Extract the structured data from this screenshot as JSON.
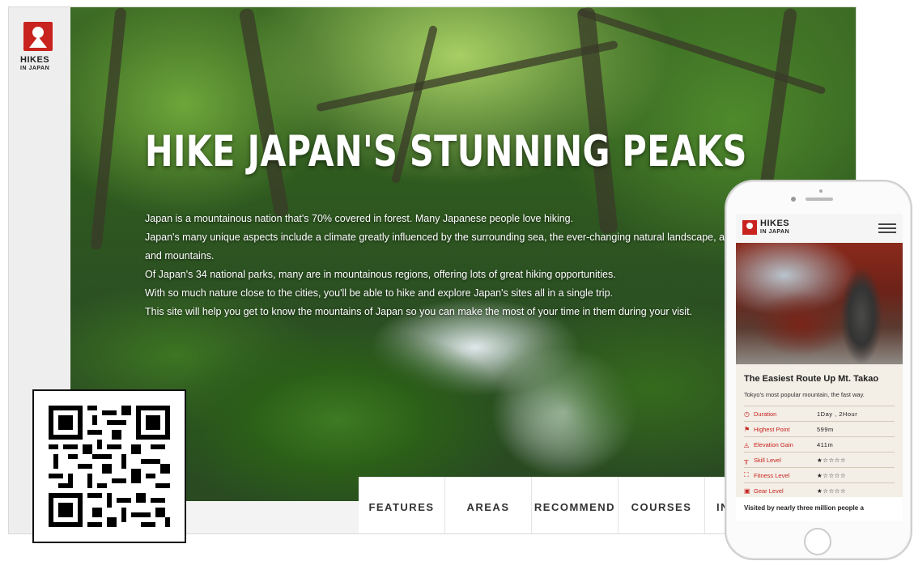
{
  "site": {
    "logo": {
      "line1": "HIKES",
      "line2": "IN JAPAN"
    }
  },
  "hero": {
    "title": "HIKE JAPAN'S STUNNING PEAKS",
    "paragraphs": [
      "Japan is a mountainous nation that's 70% covered in forest. Many Japanese people love hiking.",
      "Japan's many unique aspects include a climate greatly influenced by the surrounding sea, the ever-changing natural landscape, and th",
      "and mountains.",
      "Of Japan's 34 national parks, many are in mountainous regions, offering lots of great hiking opportunities.",
      "With so much nature close to the cities, you'll be able to hike and explore Japan's sites all in a single trip.",
      "This site will help you get to know the mountains of Japan so you can make the most of your time in them during your visit."
    ]
  },
  "nav": {
    "items": [
      "FEATURES",
      "AREAS",
      "RECOMMEND",
      "COURSES",
      "IN"
    ]
  },
  "phone": {
    "logo": {
      "line1": "HIKES",
      "line2": "IN JAPAN"
    },
    "card": {
      "title": "The Easiest Route Up Mt. Takao",
      "subtitle": "Tokyo's most popular mountain, the fast way.",
      "rows": [
        {
          "icon": "clock-icon",
          "label": "Duration",
          "value": "1Day , 2Hour"
        },
        {
          "icon": "flag-icon",
          "label": "Highest Point",
          "value": "599m"
        },
        {
          "icon": "elevation-icon",
          "label": "Elevation Gain",
          "value": "411m"
        },
        {
          "icon": "poles-icon",
          "label": "Skill Level",
          "value": "★☆☆☆☆"
        },
        {
          "icon": "fitness-icon",
          "label": "Fitness Level",
          "value": "★☆☆☆☆"
        },
        {
          "icon": "backpack-icon",
          "label": "Gear Level",
          "value": "★☆☆☆☆"
        }
      ]
    },
    "footer_text": "Visited by nearly three million people a"
  },
  "colors": {
    "brand_red": "#c8231f",
    "forest_green": "#2f5a1f"
  }
}
